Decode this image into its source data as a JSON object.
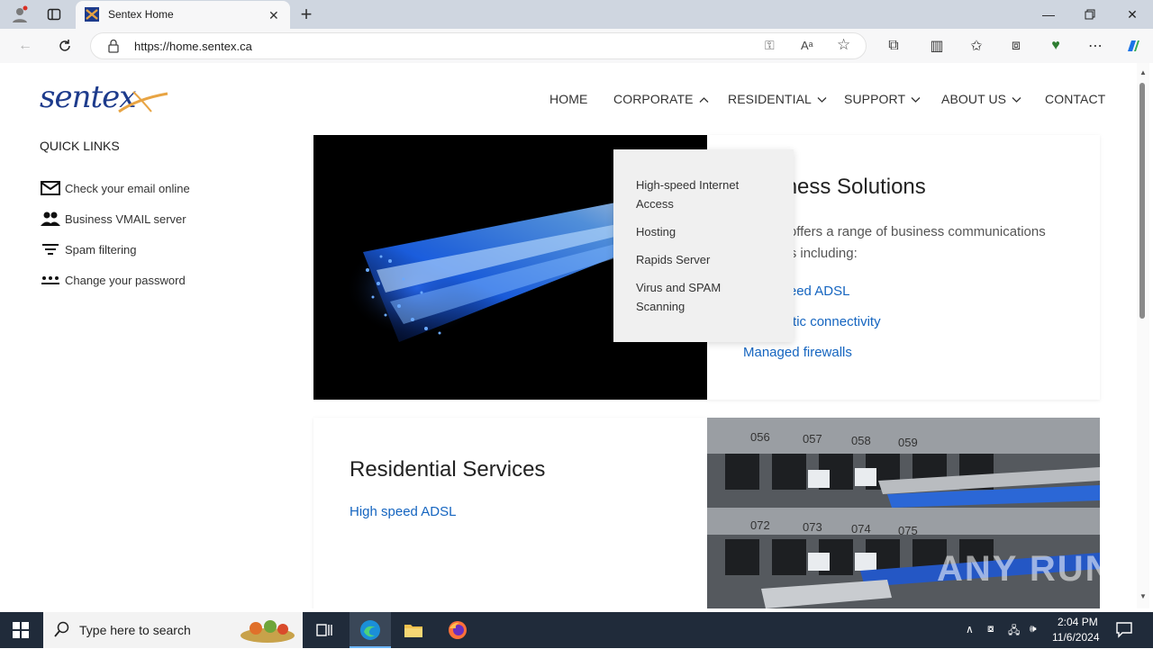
{
  "browser": {
    "tab_title": "Sentex Home",
    "url": "https://home.sentex.ca"
  },
  "site": {
    "logo_text": "sentex",
    "nav": [
      {
        "label": "HOME",
        "has_menu": false
      },
      {
        "label": "CORPORATE",
        "has_menu": true,
        "open": true
      },
      {
        "label": "RESIDENTIAL",
        "has_menu": true
      },
      {
        "label": "SUPPORT",
        "has_menu": true
      },
      {
        "label": "ABOUT US",
        "has_menu": true
      },
      {
        "label": "CONTACT",
        "has_menu": false
      }
    ],
    "corporate_menu": [
      "High-speed Internet Access",
      "Hosting",
      "Rapids Server",
      "Virus and SPAM Scanning"
    ],
    "quick_links": {
      "title": "QUICK LINKS",
      "items": [
        {
          "label": "Check your email online",
          "icon": "mail-icon"
        },
        {
          "label": "Business VMAIL server",
          "icon": "people-icon"
        },
        {
          "label": "Spam filtering",
          "icon": "filter-icon"
        },
        {
          "label": "Change your password",
          "icon": "password-icon"
        }
      ]
    },
    "business": {
      "title": "Business Solutions",
      "description": "Sentex offers a range of business communications solutions including:",
      "links": [
        "High speed ADSL",
        "Fibre optic connectivity",
        "Managed firewalls"
      ]
    },
    "residential": {
      "title": "Residential Services",
      "links": [
        "High speed ADSL"
      ]
    },
    "port_labels": [
      "056",
      "057",
      "058",
      "059",
      "072",
      "073",
      "074",
      "075"
    ]
  },
  "watermark": "ANY RUN",
  "taskbar": {
    "search_placeholder": "Type here to search",
    "time": "2:04 PM",
    "date": "11/6/2024"
  },
  "colors": {
    "link": "#1565c0",
    "logo_blue": "#1d3b8c",
    "logo_orange": "#e8a443"
  }
}
